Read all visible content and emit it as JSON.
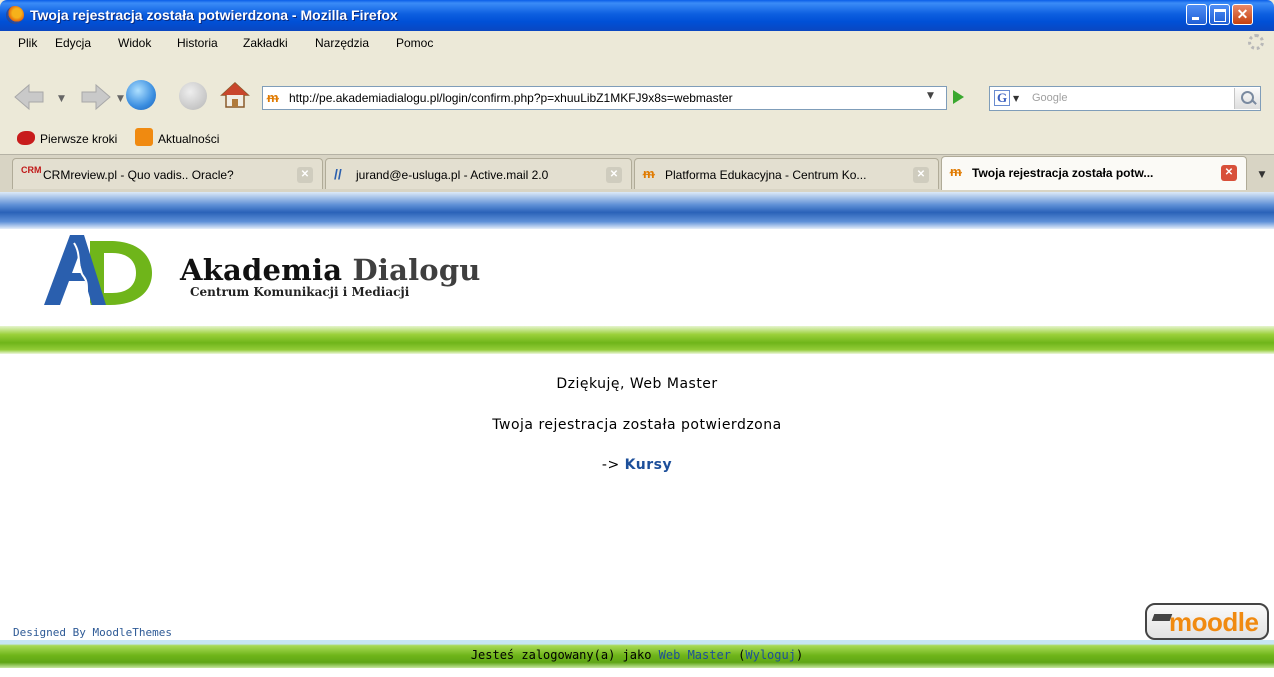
{
  "window": {
    "title": "Twoja rejestracja została potwierdzona - Mozilla Firefox"
  },
  "menu": {
    "items": [
      "Plik",
      "Edycja",
      "Widok",
      "Historia",
      "Zakładki",
      "Narzędzia",
      "Pomoc"
    ]
  },
  "navigation": {
    "url": "http://pe.akademiadialogu.pl/login/confirm.php?p=xhuuLibZ1MKFJ9x8s=webmaster",
    "search_engine_icon": "G",
    "search_placeholder": "Google"
  },
  "bookmarks": {
    "items": [
      "Pierwsze kroki",
      "Aktualności"
    ]
  },
  "tabs": [
    {
      "favicon": "CRM",
      "label": "CRMreview.pl - Quo vadis.. Oracle?",
      "active": false
    },
    {
      "favicon": "feather-icon",
      "label": "jurand@e-usluga.pl - Active.mail 2.0",
      "active": false
    },
    {
      "favicon": "moodle-icon",
      "label": "Platforma Edukacyjna - Centrum Ko...",
      "active": false
    },
    {
      "favicon": "moodle-icon",
      "label": "Twoja rejestracja została potw...",
      "active": true
    }
  ],
  "page": {
    "logo_title_1": "Akademia",
    "logo_title_2": "Dialogu",
    "logo_subtitle": "Centrum Komunikacji i Mediacji",
    "thanks": "Dziękuję, Web Master",
    "message": "Twoja rejestracja została potwierdzona",
    "courses_arrow": "->",
    "courses_link": "Kursy",
    "designed_by": "Designed By MoodleThemes",
    "moodle_badge": "moodle",
    "login_prefix": "Jesteś zalogowany(a) jako",
    "login_user": "Web Master",
    "logout_link": "Wyloguj",
    "logo_colors": {
      "blue": "#2a5fae",
      "green": "#6fb51a"
    }
  }
}
